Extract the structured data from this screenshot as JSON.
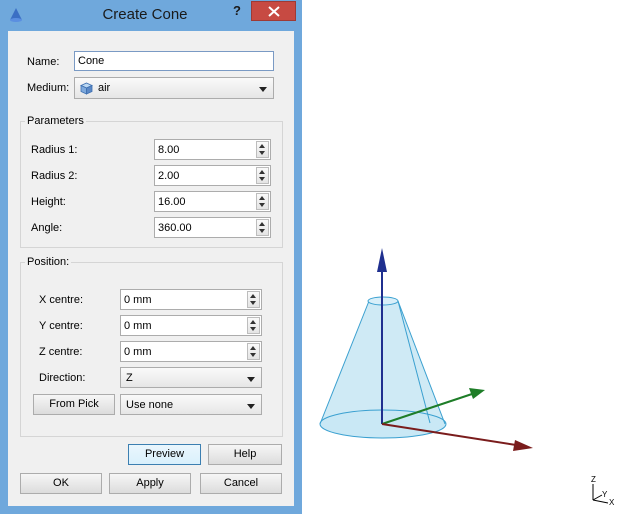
{
  "dialog": {
    "title": "Create Cone",
    "help": "?",
    "name_label": "Name:",
    "name_value": "Cone",
    "medium_label": "Medium:",
    "medium_value": "air",
    "medium_icon": "cube-icon",
    "parameters": {
      "title": "Parameters",
      "radius1_label": "Radius 1:",
      "radius1_value": "8.00",
      "radius2_label": "Radius 2:",
      "radius2_value": "2.00",
      "height_label": "Height:",
      "height_value": "16.00",
      "angle_label": "Angle:",
      "angle_value": "360.00"
    },
    "position": {
      "title": "Position:",
      "x_label": "X centre:",
      "x_value": "0 mm",
      "y_label": "Y centre:",
      "y_value": "0 mm",
      "z_label": "Z centre:",
      "z_value": "0 mm",
      "direction_label": "Direction:",
      "direction_value": "Z",
      "from_pick": "From Pick",
      "pick_value": "Use none"
    },
    "buttons": {
      "preview": "Preview",
      "help": "Help",
      "ok": "OK",
      "apply": "Apply",
      "cancel": "Cancel"
    }
  },
  "viewport": {
    "triad": {
      "z": "Z",
      "y": "Y",
      "x": "X"
    },
    "colors": {
      "z_axis": "#1f2f8f",
      "y_axis": "#1e7d28",
      "x_axis": "#7a1c1c",
      "cone_fill": "#bfe3f2",
      "cone_edge": "#3aa0d0"
    }
  }
}
